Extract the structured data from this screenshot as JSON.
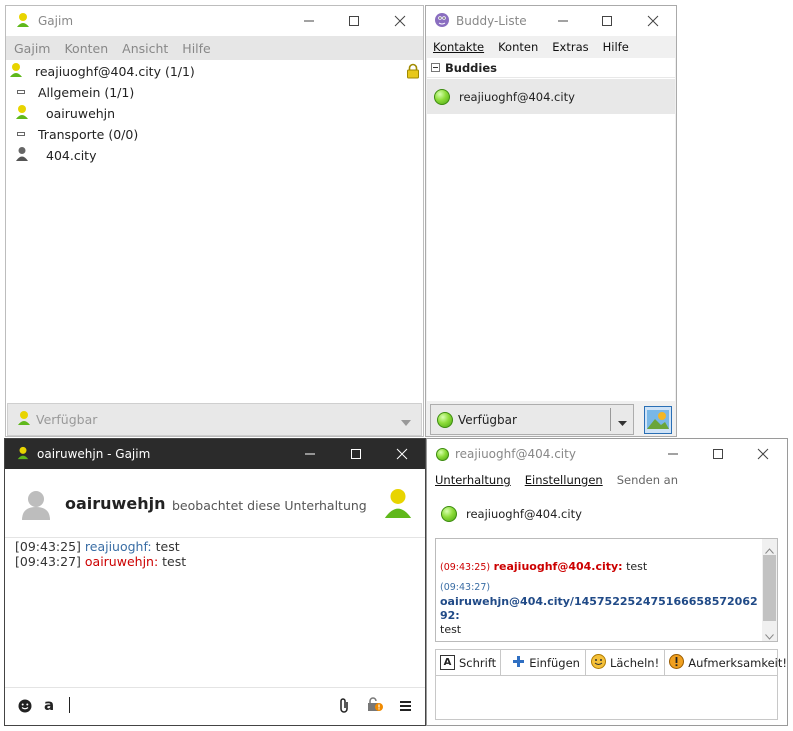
{
  "gajim_main": {
    "title": "Gajim",
    "menu": [
      "Gajim",
      "Konten",
      "Ansicht",
      "Hilfe"
    ],
    "roster": [
      {
        "label": "reajiuoghf@404.city (1/1)"
      },
      {
        "label": "Allgemein (1/1)"
      },
      {
        "label": "oairuwehjn"
      },
      {
        "label": "Transporte (0/0)"
      },
      {
        "label": "404.city"
      }
    ],
    "status": "Verfügbar"
  },
  "buddy": {
    "title": "Buddy-Liste",
    "menu": [
      "Kontakte",
      "Konten",
      "Extras",
      "Hilfe"
    ],
    "group": "Buddies",
    "contact": "reajiuoghf@404.city",
    "status": "Verfügbar"
  },
  "gajim_chat": {
    "title": "oairuwehjn - Gajim",
    "contact_name": "oairuwehjn",
    "contact_status": "beobachtet diese Unterhaltung",
    "messages": [
      {
        "time": "[09:43:25]",
        "sender": "reajiuoghf:",
        "text": " test"
      },
      {
        "time": "[09:43:27]",
        "sender": "oairuwehjn:",
        "text": " test"
      }
    ]
  },
  "pidgin_chat": {
    "title": "reajiuoghf@404.city",
    "menu": [
      "Unterhaltung",
      "Einstellungen",
      "Senden an"
    ],
    "contact": "reajiuoghf@404.city",
    "messages": [
      {
        "time": "(09:43:25)",
        "sender": "reajiuoghf@404.city:",
        "text": "test"
      },
      {
        "time": "(09:43:27)",
        "sender": "oairuwehjn@404.city/1457522524751666585720629​2:",
        "text": "test"
      }
    ],
    "toolbar": [
      "Schrift",
      "Einfügen",
      "Lächeln!",
      "Aufmerksamkeit!"
    ]
  },
  "colors": {
    "red": "#cc0000",
    "blue": "#3a6ea5",
    "green": "#4aa512"
  }
}
